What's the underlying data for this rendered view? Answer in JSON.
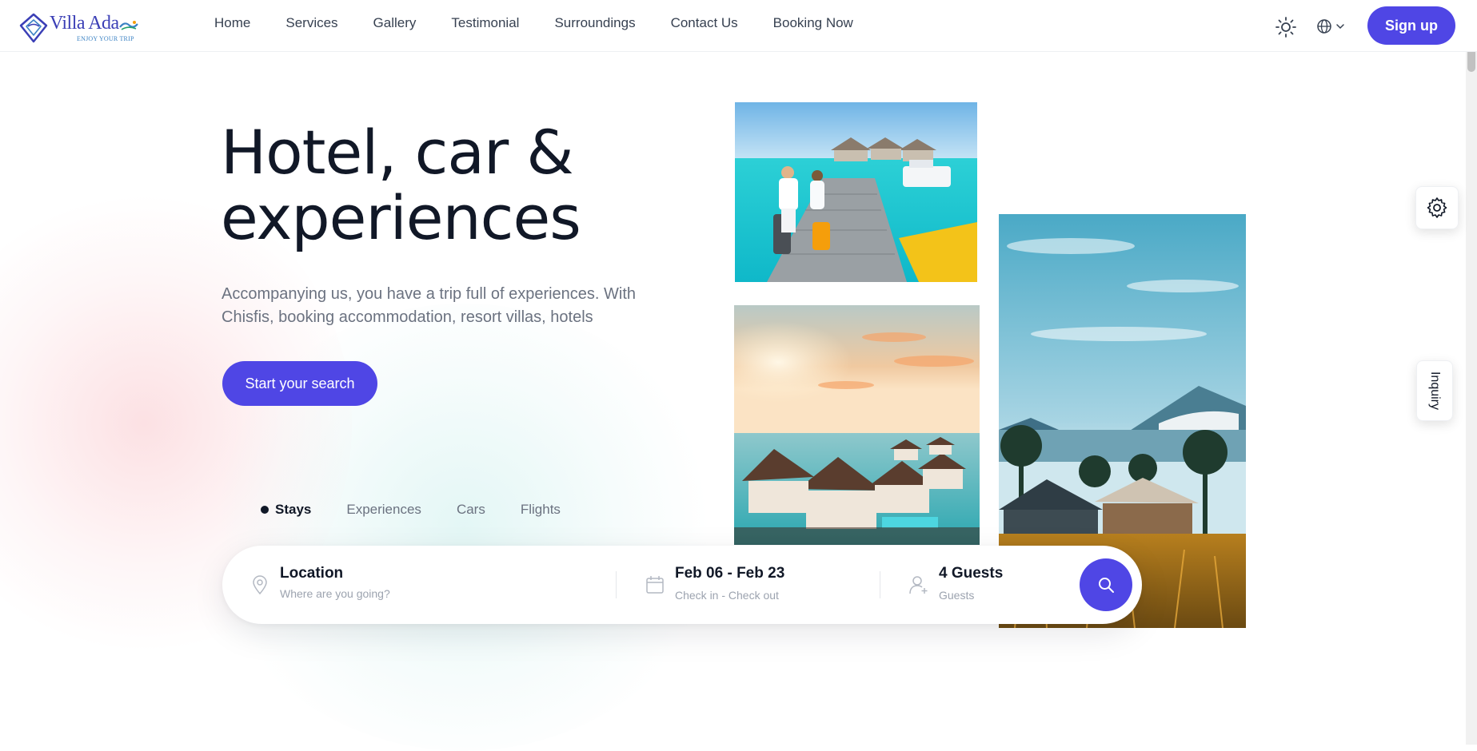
{
  "brand": {
    "name": "Villa Ada",
    "tagline": "ENJOY YOUR TRIP",
    "accent_color": "#4f46e5"
  },
  "nav": {
    "items": [
      {
        "label": "Home"
      },
      {
        "label": "Services"
      },
      {
        "label": "Gallery"
      },
      {
        "label": "Testimonial"
      },
      {
        "label": "Surroundings"
      },
      {
        "label": "Contact Us"
      },
      {
        "label": "Booking Now"
      }
    ],
    "theme_icon": "sun-icon",
    "language_icon": "globe-icon",
    "signup_label": "Sign up"
  },
  "hero": {
    "title_line1": "Hotel, car &",
    "title_line2": "experiences",
    "description": "Accompanying us, you have a trip full of experiences. With Chisfis, booking accommodation, resort villas, hotels",
    "cta_label": "Start your search"
  },
  "search": {
    "tabs": [
      {
        "label": "Stays",
        "active": true
      },
      {
        "label": "Experiences",
        "active": false
      },
      {
        "label": "Cars",
        "active": false
      },
      {
        "label": "Flights",
        "active": false
      }
    ],
    "location_label": "Location",
    "location_placeholder": "Where are you going?",
    "dates_value": "Feb 06 - Feb 23",
    "dates_sub": "Check in - Check out",
    "guests_value": "4 Guests",
    "guests_sub": "Guests",
    "submit_icon": "search-icon"
  },
  "floating": {
    "settings_icon": "gear-icon",
    "inquiry_label": "Inquiry"
  }
}
